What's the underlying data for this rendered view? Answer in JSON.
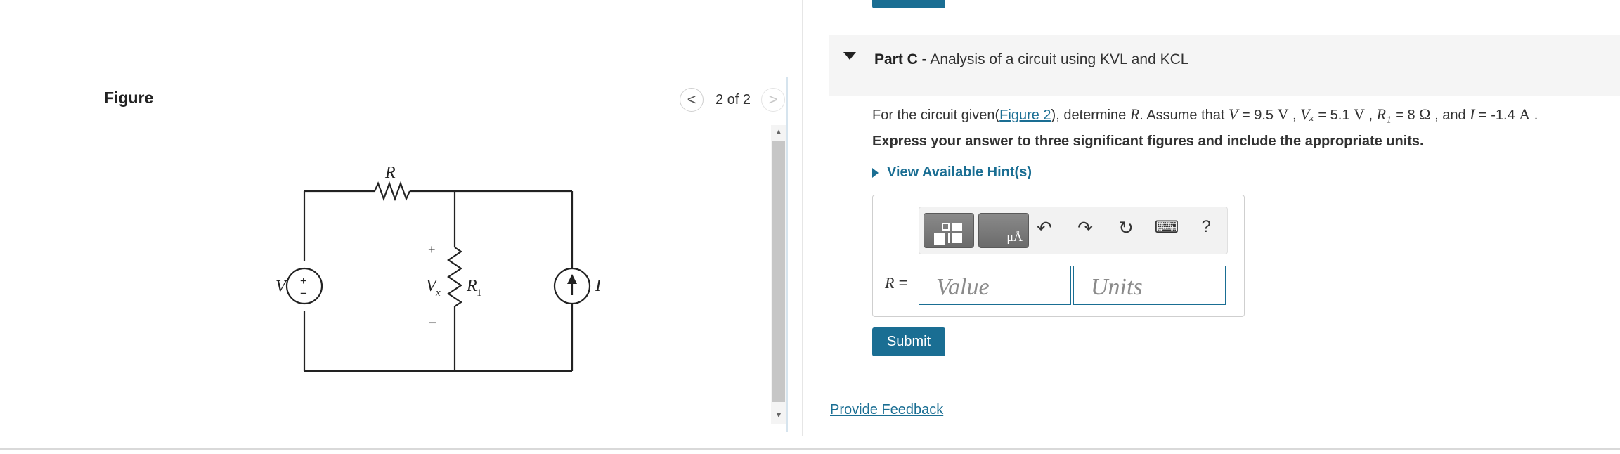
{
  "figure_panel": {
    "title": "Figure",
    "pager": "2 of 2",
    "prev_glyph": "<",
    "next_glyph": ">"
  },
  "circuit": {
    "source_voltage_label": "V",
    "resistor_top_label": "R",
    "vx_label": "V",
    "vx_subscript": "x",
    "r1_label": "R",
    "r1_subscript": "1",
    "plus": "+",
    "minus": "−",
    "current_label": "I"
  },
  "part": {
    "prefix": "Part C -",
    "title": "Analysis of a circuit using KVL and KCL"
  },
  "problem": {
    "text1": "For the circuit given(",
    "figure_link": "Figure 2",
    "text2": "), determine ",
    "var_R": "R",
    "text3": ". Assume that ",
    "var_V": "V",
    "val_V": " = 9.5 ",
    "unit_V1": "V",
    "sep1": " , ",
    "var_Vx": "Vₓ",
    "val_Vx": " = 5.1 ",
    "unit_V2": "V",
    "sep2": " , ",
    "var_R1": "R₁",
    "val_R1": " = 8 ",
    "unit_ohm": "Ω",
    "sep3": " , and ",
    "var_I": "I",
    "val_I": " = -1.4 ",
    "unit_A": "A",
    "end": " ."
  },
  "instruction": "Express your answer to three significant figures and include the appropriate units.",
  "hint_link": "View Available Hint(s)",
  "answer": {
    "label_var": "R",
    "label_eq": " =",
    "value_placeholder": "Value",
    "units_placeholder": "Units",
    "help_glyph": "?",
    "units_tool_text": "μÅ"
  },
  "submit_label": "Submit",
  "feedback_label": "Provide Feedback",
  "colors": {
    "accent": "#1a6e93",
    "scrollbar_thumb": "#c6c6c6",
    "header_bg": "#f5f5f5"
  }
}
